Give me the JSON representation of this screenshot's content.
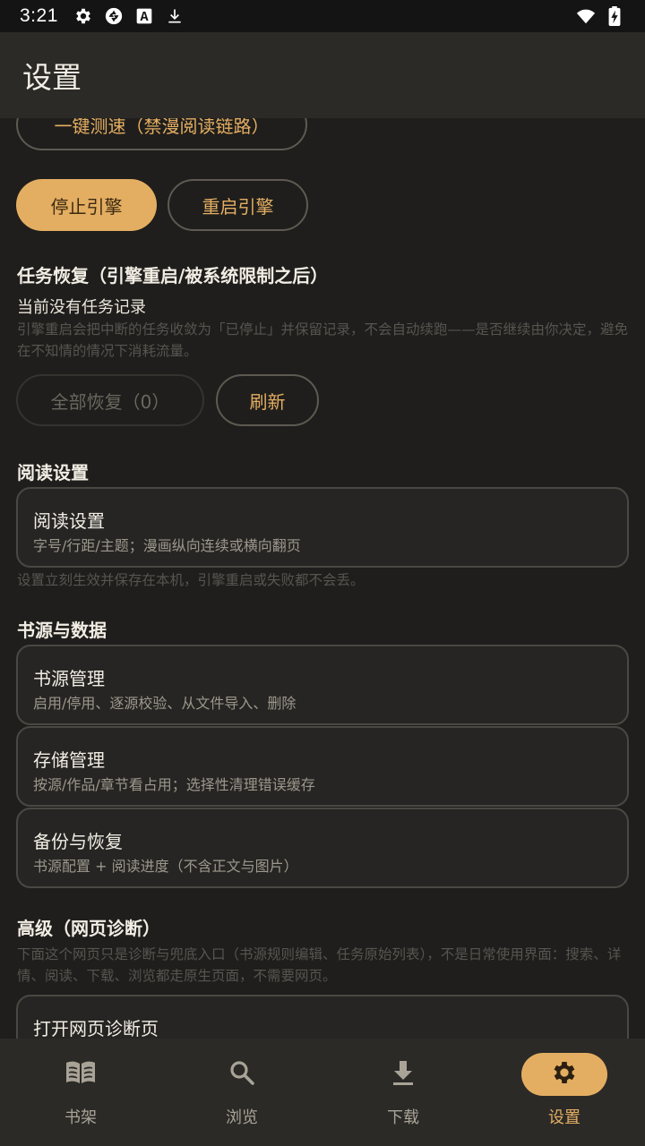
{
  "status_bar": {
    "time": "3:21",
    "left_icons": [
      "gear-icon",
      "aperture-icon",
      "font-a-icon",
      "download-icon"
    ],
    "right_icons": [
      "wifi-icon",
      "battery-charging-icon"
    ]
  },
  "app_bar": {
    "title": "设置"
  },
  "speed_test": {
    "button_label": "一键测速（禁漫阅读链路）"
  },
  "engine": {
    "stop_label": "停止引擎",
    "restart_label": "重启引擎"
  },
  "task_recovery": {
    "title": "任务恢复（引擎重启/被系统限制之后）",
    "status": "当前没有任务记录",
    "hint": "引擎重启会把中断的任务收敛为「已停止」并保留记录，不会自动续跑——是否继续由你决定，避免在不知情的情况下消耗流量。",
    "restore_all_label": "全部恢复（0）",
    "refresh_label": "刷新"
  },
  "reading": {
    "section_title": "阅读设置",
    "card": {
      "title": "阅读设置",
      "subtitle": "字号/行距/主题；漫画纵向连续或横向翻页"
    },
    "hint": "设置立刻生效并保存在本机，引擎重启或失败都不会丢。"
  },
  "sources": {
    "section_title": "书源与数据",
    "cards": [
      {
        "title": "书源管理",
        "subtitle": "启用/停用、逐源校验、从文件导入、删除"
      },
      {
        "title": "存储管理",
        "subtitle": "按源/作品/章节看占用；选择性清理错误缓存"
      },
      {
        "title": "备份与恢复",
        "subtitle": "书源配置 + 阅读进度（不含正文与图片）"
      }
    ]
  },
  "advanced": {
    "section_title": "高级（网页诊断）",
    "hint": "下面这个网页只是诊断与兜底入口（书源规则编辑、任务原始列表），不是日常使用界面：搜索、详情、阅读、下载、浏览都走原生页面，不需要网页。",
    "card": {
      "title": "打开网页诊断页"
    }
  },
  "bottom_nav": {
    "items": [
      {
        "label": "书架",
        "icon": "book-icon"
      },
      {
        "label": "浏览",
        "icon": "search-icon"
      },
      {
        "label": "下载",
        "icon": "download-icon"
      },
      {
        "label": "设置",
        "icon": "gear-icon"
      }
    ],
    "active_index": 3
  },
  "colors": {
    "accent": "#e4ae62",
    "background": "#1f1e1c",
    "surface": "#2b2a27",
    "outline": "#4a4843"
  }
}
